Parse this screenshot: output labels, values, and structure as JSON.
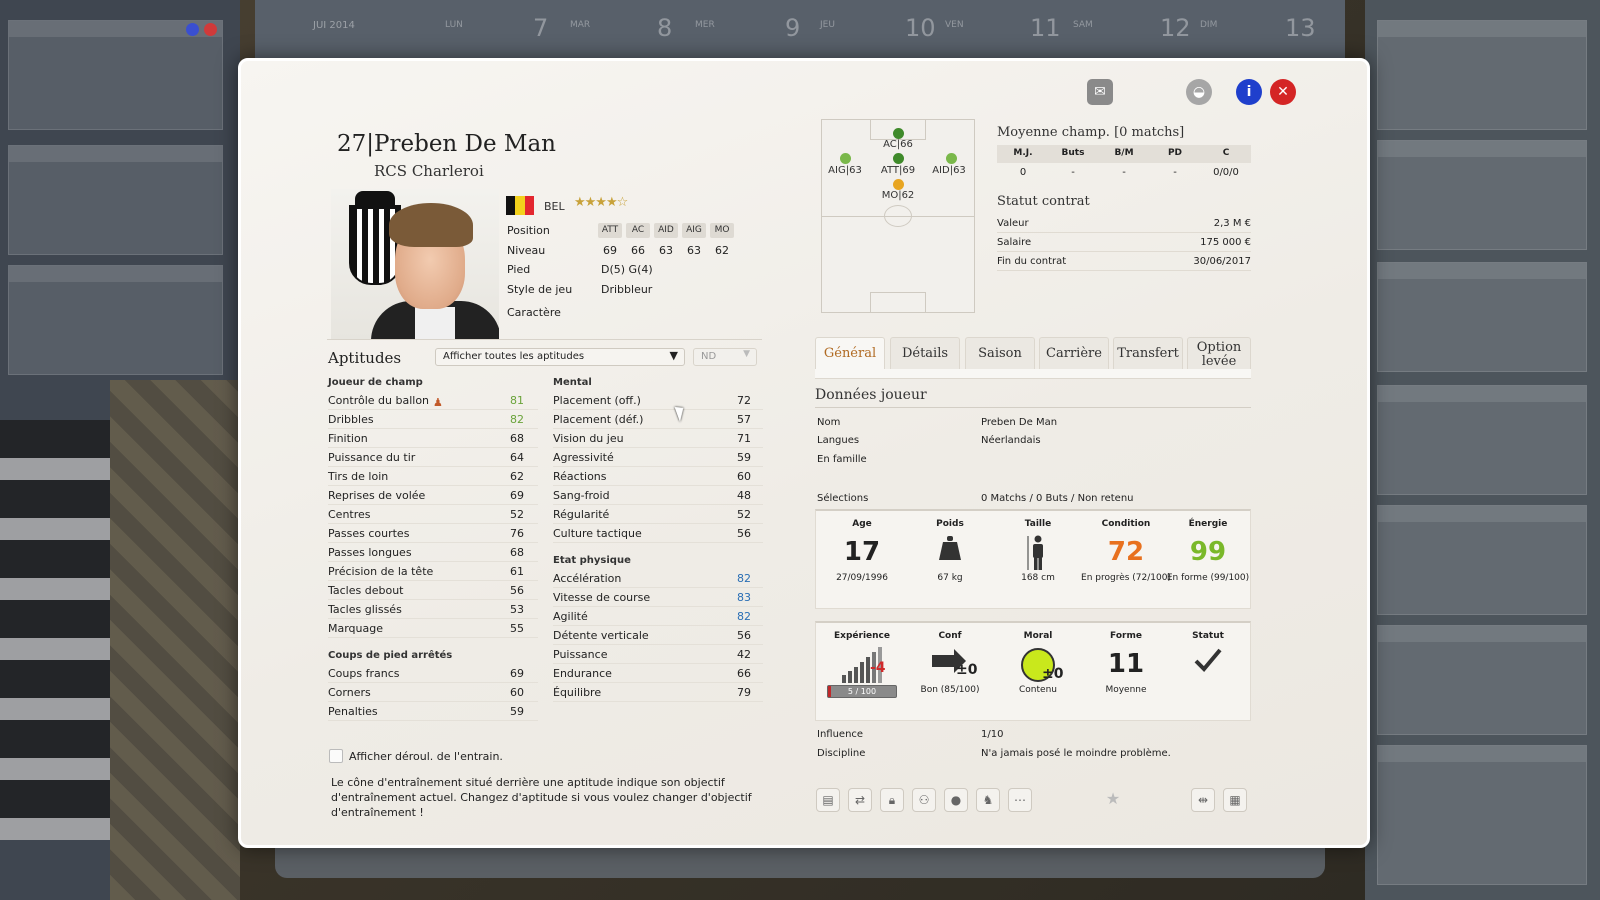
{
  "calendar": {
    "month": "JUI 2014",
    "days": [
      {
        "label": "LUN",
        "num": "7"
      },
      {
        "label": "MAR",
        "num": "8"
      },
      {
        "label": "MER",
        "num": "9"
      },
      {
        "label": "JEU",
        "num": "10"
      },
      {
        "label": "VEN",
        "num": "11"
      },
      {
        "label": "SAM",
        "num": "12"
      },
      {
        "label": "DIM",
        "num": "13"
      }
    ]
  },
  "player": {
    "number": "27|",
    "name": "Preben De Man",
    "club": "RCS Charleroi",
    "nationality": "BEL",
    "stars": "★★★★☆",
    "colors": {
      "flag_black": "#111111",
      "flag_yellow": "#f3d11c",
      "flag_red": "#e3272f"
    }
  },
  "info": {
    "position_label": "Position",
    "positions": [
      "ATT",
      "AC",
      "AID",
      "AIG",
      "MO"
    ],
    "niveau_label": "Niveau",
    "niveau_values": [
      "69",
      "66",
      "63",
      "63",
      "62"
    ],
    "pied_label": "Pied",
    "pied_value": "D(5) G(4)",
    "style_label": "Style de jeu",
    "style_value": "Dribbleur",
    "caractere_label": "Caractère"
  },
  "aptitudes": {
    "title": "Aptitudes",
    "filter": "Afficher toutes les aptitudes",
    "nd": "ND",
    "field_title": "Joueur de champ",
    "field": [
      {
        "name": "Contrôle du ballon",
        "value": "81"
      },
      {
        "name": "Dribbles",
        "value": "82"
      },
      {
        "name": "Finition",
        "value": "68"
      },
      {
        "name": "Puissance du tir",
        "value": "64"
      },
      {
        "name": "Tirs de loin",
        "value": "62"
      },
      {
        "name": "Reprises de volée",
        "value": "69"
      },
      {
        "name": "Centres",
        "value": "52"
      },
      {
        "name": "Passes courtes",
        "value": "76"
      },
      {
        "name": "Passes longues",
        "value": "68"
      },
      {
        "name": "Précision de la tête",
        "value": "61"
      },
      {
        "name": "Tacles debout",
        "value": "56"
      },
      {
        "name": "Tacles glissés",
        "value": "53"
      },
      {
        "name": "Marquage",
        "value": "55"
      }
    ],
    "setpiece_title": "Coups de pied arrêtés",
    "setpiece": [
      {
        "name": "Coups francs",
        "value": "69"
      },
      {
        "name": "Corners",
        "value": "60"
      },
      {
        "name": "Penalties",
        "value": "59"
      }
    ],
    "mental_title": "Mental",
    "mental": [
      {
        "name": "Placement (off.)",
        "value": "72"
      },
      {
        "name": "Placement (déf.)",
        "value": "57"
      },
      {
        "name": "Vision du jeu",
        "value": "71"
      },
      {
        "name": "Agressivité",
        "value": "59"
      },
      {
        "name": "Réactions",
        "value": "60"
      },
      {
        "name": "Sang-froid",
        "value": "48"
      },
      {
        "name": "Régularité",
        "value": "52"
      },
      {
        "name": "Culture tactique",
        "value": "56"
      }
    ],
    "physical_title": "Etat physique",
    "physical": [
      {
        "name": "Accélération",
        "value": "82"
      },
      {
        "name": "Vitesse de course",
        "value": "83"
      },
      {
        "name": "Agilité",
        "value": "82"
      },
      {
        "name": "Détente verticale",
        "value": "56"
      },
      {
        "name": "Puissance",
        "value": "42"
      },
      {
        "name": "Endurance",
        "value": "66"
      },
      {
        "name": "Équilibre",
        "value": "79"
      }
    ],
    "colors": {
      "green": "#6aa33a",
      "blue": "#2a6fb5"
    },
    "show_training": "Afficher déroul. de l'entrain.",
    "note": "Le cône d'entraînement situé derrière une aptitude indique son objectif d'entraînement actuel. Changez d'aptitude si vous voulez changer d'objectif d'entraînement !"
  },
  "pitch": {
    "positions": [
      {
        "label": "AC|66",
        "color": "#3f8a2a"
      },
      {
        "label": "AIG|63",
        "color": "#7ab84a"
      },
      {
        "label": "ATT|69",
        "color": "#3f8a2a"
      },
      {
        "label": "AID|63",
        "color": "#7ab84a"
      },
      {
        "label": "MO|62",
        "color": "#e8a521"
      }
    ]
  },
  "stats": {
    "title": "Moyenne champ. [0 matchs]",
    "headers": [
      "M.J.",
      "Buts",
      "B/M",
      "PD",
      "C"
    ],
    "values": [
      "0",
      "-",
      "-",
      "-",
      "0/0/0"
    ]
  },
  "contract": {
    "title": "Statut contrat",
    "rows": [
      {
        "label": "Valeur",
        "value": "2,3 M €"
      },
      {
        "label": "Salaire",
        "value": "175 000 €"
      },
      {
        "label": "Fin du contrat",
        "value": "30/06/2017"
      }
    ]
  },
  "tabs": [
    "Général",
    "Détails",
    "Saison",
    "Carrière",
    "Transfert",
    "Option levée"
  ],
  "donnees": {
    "title": "Données joueur",
    "nom_label": "Nom",
    "nom": "Preben De Man",
    "langues_label": "Langues",
    "langues": "Néerlandais",
    "famille_label": "En famille",
    "selections_label": "Sélections",
    "selections": "0 Matchs / 0 Buts / Non retenu"
  },
  "vitals": {
    "age_h": "Age",
    "age": "17",
    "dob": "27/09/1996",
    "poids_h": "Poids",
    "poids": "67 kg",
    "taille_h": "Taille",
    "taille": "168 cm",
    "condition_h": "Condition",
    "condition": "72",
    "condition_s": "En progrès (72/100)",
    "energie_h": "Énergie",
    "energie": "99",
    "energie_s": "En forme (99/100)",
    "colors": {
      "condition": "#e8711f",
      "energie": "#7ab82a"
    }
  },
  "status": {
    "exp_h": "Expérience",
    "exp_delta": "-4",
    "exp_bar": "5 / 100",
    "exp_fraction": 0.05,
    "conf_h": "Conf",
    "conf_delta": "±0",
    "conf_s": "Bon (85/100)",
    "moral_h": "Moral",
    "moral_delta": "±0",
    "moral_s": "Contenu",
    "forme_h": "Forme",
    "forme": "11",
    "forme_s": "Moyenne",
    "statut_h": "Statut"
  },
  "influence_label": "Influence",
  "influence": "1/10",
  "discipline_label": "Discipline",
  "discipline": "N'a jamais posé le moindre problème."
}
